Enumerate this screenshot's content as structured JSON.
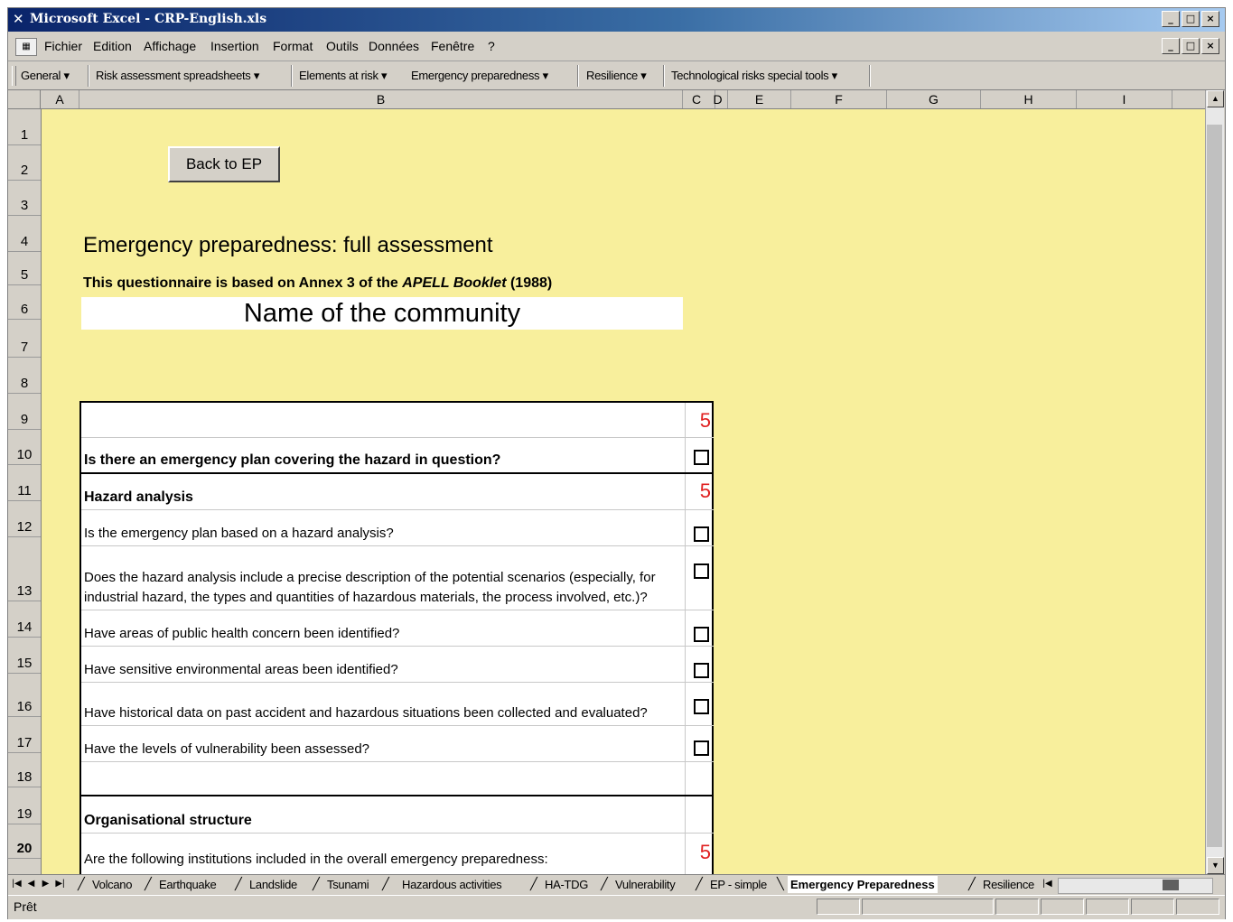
{
  "window": {
    "title": "Microsoft Excel - CRP-English.xls",
    "min": "_",
    "max": "□",
    "close": "×"
  },
  "menu": [
    "Fichier",
    "Edition",
    "Affichage",
    "Insertion",
    "Format",
    "Outils",
    "Données",
    "Fenêtre",
    "?"
  ],
  "toolbar": [
    "General ▾",
    "Risk assessment spreadsheets ▾",
    "Elements at risk ▾",
    "Emergency preparedness ▾",
    "Resilience ▾",
    "Technological risks special tools ▾"
  ],
  "columns": [
    "A",
    "B",
    "C",
    "D",
    "E",
    "F",
    "G",
    "H",
    "I"
  ],
  "rows": [
    "1",
    "2",
    "3",
    "4",
    "5",
    "6",
    "7",
    "8",
    "9",
    "10",
    "11",
    "12",
    "13",
    "14",
    "15",
    "16",
    "17",
    "18",
    "19",
    "20"
  ],
  "sheet": {
    "back_button": "Back to EP",
    "heading": "Emergency preparedness: full assessment",
    "subtitle_pre": "This questionnaire is based on Annex 3 of the ",
    "subtitle_em": "APELL Booklet",
    "subtitle_post": " (1988)",
    "community_name": "Name of the community"
  },
  "questions": {
    "r9_score": "5",
    "r10": "Is there an emergency plan covering the hazard in question?",
    "r11": "Hazard analysis",
    "r11_score": "5",
    "r12": "Is the emergency plan based on a hazard analysis?",
    "r13": "Does the hazard analysis include a precise description of the potential scenarios (especially, for industrial hazard, the types and quantities of hazardous materials, the process involved, etc.)?",
    "r14": "Have areas of public health concern been identified?",
    "r15": "Have sensitive environmental areas been identified?",
    "r16": "Have historical data on past accident and hazardous situations been collected and evaluated?",
    "r17": "Have the levels of vulnerability been assessed?",
    "r19": "Organisational structure",
    "r20": "Are the following institutions included in the overall emergency preparedness:",
    "r20_score": "5"
  },
  "tabs": [
    "Volcano",
    "Earthquake",
    "Landslide",
    "Tsunami",
    "Hazardous activities",
    "HA-TDG",
    "Vulnerability",
    "EP - simple",
    "Emergency Preparedness",
    "Resilience"
  ],
  "active_tab": "Emergency Preparedness",
  "status": "Prêt"
}
